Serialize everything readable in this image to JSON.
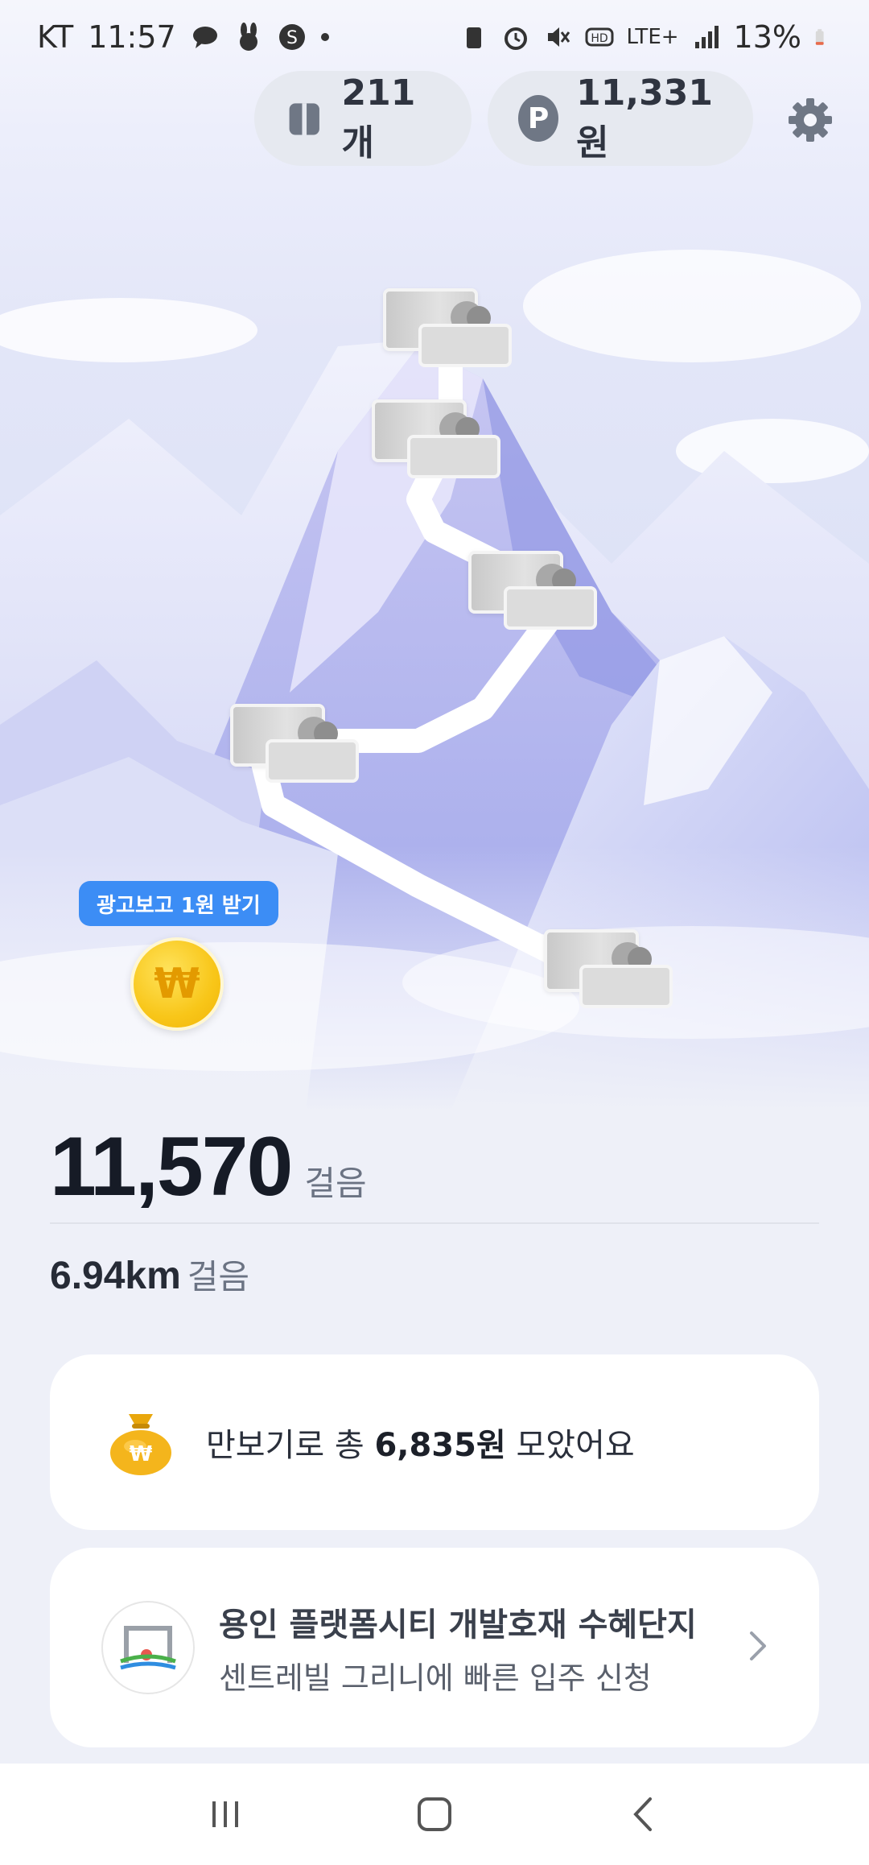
{
  "status_bar": {
    "carrier": "KT",
    "time": "11:57",
    "battery": "13%",
    "network": "LTE+"
  },
  "header": {
    "gift_count": "211개",
    "points": "11,331원",
    "point_badge": "P"
  },
  "map": {
    "ad_button_label": "광고보고 1원 받기",
    "coin_symbol": "₩"
  },
  "steps": {
    "count": "11,570",
    "unit": "걸음",
    "distance": "6.94km",
    "distance_unit": "걸음"
  },
  "savings_card": {
    "prefix": "만보기로 총 ",
    "amount": "6,835원",
    "suffix": " 모았어요"
  },
  "ad_card": {
    "title": "용인 플랫폼시티 개발호재 수혜단지",
    "subtitle": "센트레빌 그리니에 빠른 입주 신청"
  },
  "colors": {
    "accent_blue": "#3c8df5",
    "coin_yellow": "#f8c619",
    "text_dark": "#161b26"
  }
}
